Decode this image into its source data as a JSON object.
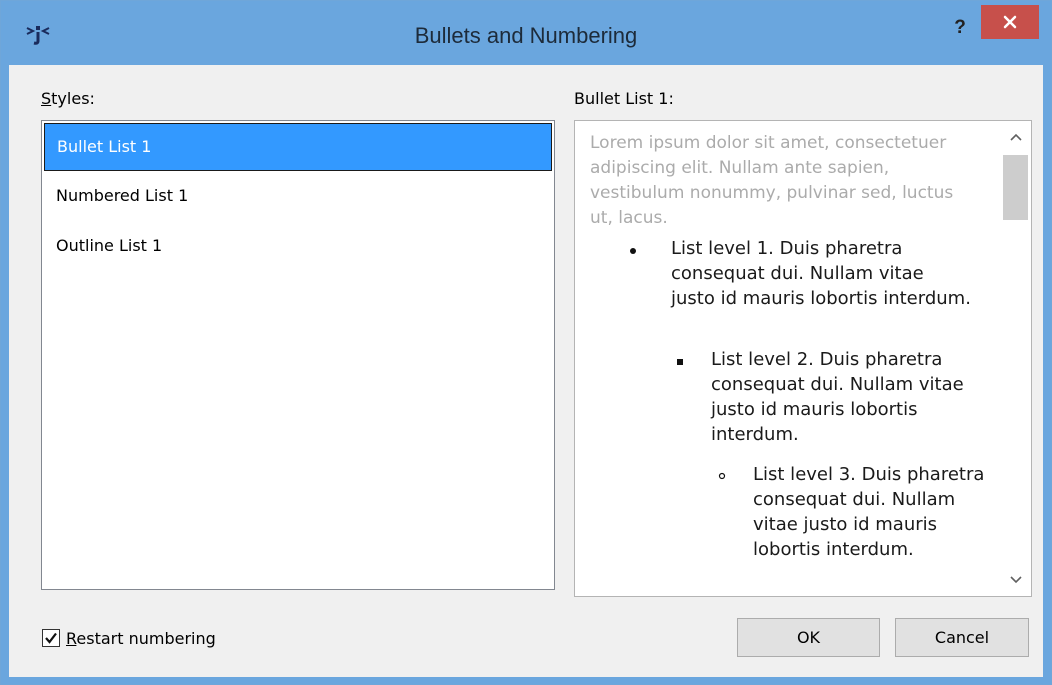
{
  "window": {
    "title": "Bullets and Numbering",
    "help_label": "?",
    "icons": {
      "app": "dialog-app-icon",
      "close": "close-icon",
      "help": "help-icon"
    }
  },
  "styles": {
    "label_prefix": "S",
    "label_rest": "tyles:",
    "items": [
      {
        "label": "Bullet List 1",
        "selected": true
      },
      {
        "label": "Numbered List 1",
        "selected": false
      },
      {
        "label": "Outline List 1",
        "selected": false
      }
    ]
  },
  "preview": {
    "label": "Bullet List 1:",
    "lorem": "Lorem ipsum dolor sit amet, consectetuer adipiscing elit. Nullam ante sapien, vestibulum nonummy, pulvinar sed, luctus ut, lacus.",
    "levels": [
      {
        "bullet": "disc",
        "text": "List level 1. Duis pharetra consequat dui. Nullam vitae justo id mauris lobortis interdum."
      },
      {
        "bullet": "square",
        "text": "List level 2. Duis pharetra consequat dui. Nullam vitae justo id mauris lobortis interdum."
      },
      {
        "bullet": "circle",
        "text": "List level 3. Duis pharetra consequat dui. Nullam vitae justo id mauris lobortis interdum."
      }
    ]
  },
  "options": {
    "restart_numbering": {
      "checked": true,
      "label_prefix": "R",
      "label_rest": "estart numbering"
    }
  },
  "buttons": {
    "ok": "OK",
    "cancel": "Cancel"
  },
  "colors": {
    "titlebar": "#6aa6de",
    "close": "#c7504b",
    "selection": "#3399ff",
    "client": "#f0f0f0"
  }
}
